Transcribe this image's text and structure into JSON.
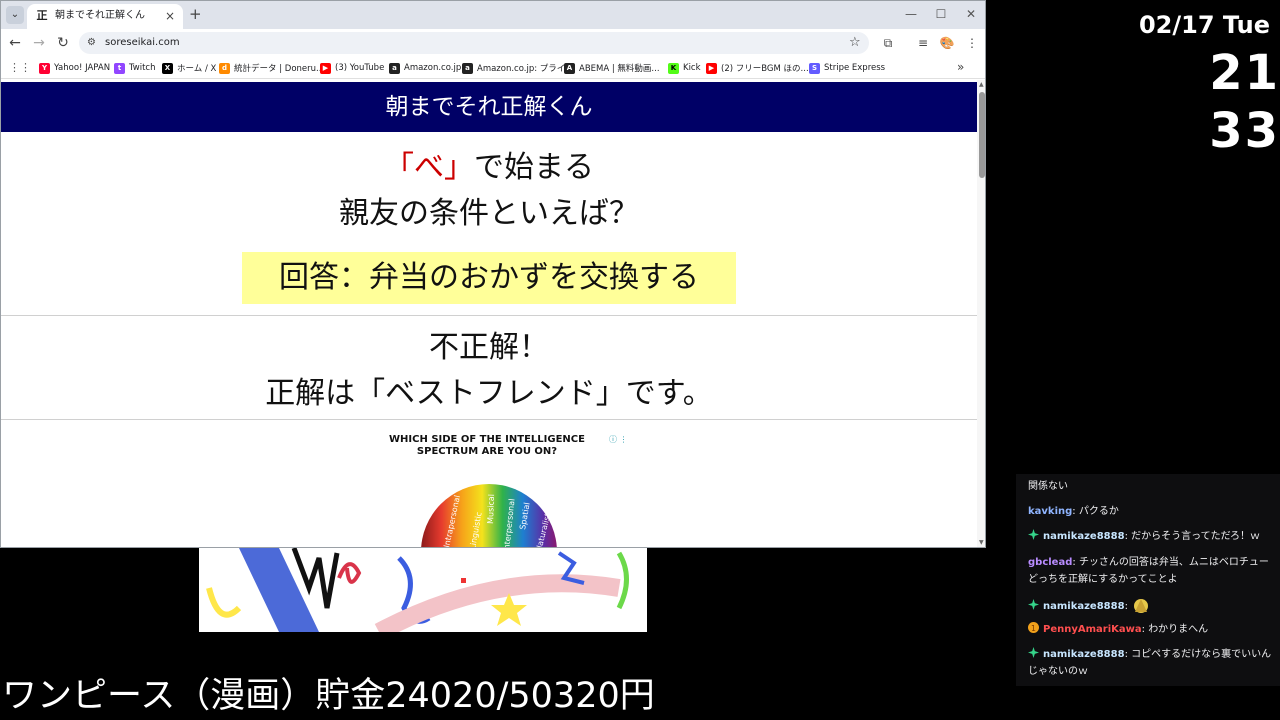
{
  "browser": {
    "tab": {
      "favicon": "正",
      "title": "朝までそれ正解くん",
      "close_icon": "×"
    },
    "new_tab_icon": "+",
    "window_controls": {
      "minimize": "—",
      "maximize": "☐",
      "close": "✕"
    },
    "tab_list_icon": "⌄",
    "toolbar": {
      "back_icon": "←",
      "forward_icon": "→",
      "reload_icon": "↻",
      "url": "soreseikai.com",
      "star_icon": "☆",
      "extensions_icon": "⧉",
      "media_icon": "≡",
      "profile_icon": "🎨",
      "menu_icon": "⋮",
      "site_info_icon": "⚙"
    },
    "bookmarks": [
      {
        "label": "Yahoo! JAPAN",
        "icon": "Y",
        "color": "#ff0033"
      },
      {
        "label": "Twitch",
        "icon": "t",
        "color": "#9146ff"
      },
      {
        "label": "ホーム / X",
        "icon": "X",
        "color": "#000000"
      },
      {
        "label": "統計データ | Doneru...",
        "icon": "d",
        "color": "#ff8a00"
      },
      {
        "label": "(3) YouTube",
        "icon": "▶",
        "color": "#ff0000"
      },
      {
        "label": "Amazon.co.jp",
        "icon": "a",
        "color": "#222222"
      },
      {
        "label": "Amazon.co.jp: プライ...",
        "icon": "a",
        "color": "#222222"
      },
      {
        "label": "ABEMA | 無料動画...",
        "icon": "A",
        "color": "#222222"
      },
      {
        "label": "Kick",
        "icon": "K",
        "color": "#53fc18"
      },
      {
        "label": "(2) フリーBGM ほの...",
        "icon": "▶",
        "color": "#ff0000"
      },
      {
        "label": "Stripe Express",
        "icon": "S",
        "color": "#635bff"
      }
    ],
    "bookmarks_more": "»",
    "apps_icon": "⋮⋮"
  },
  "page": {
    "header": "朝までそれ正解くん",
    "question_letter": "「べ」",
    "question_line1_rest": "で始まる",
    "question_line2": "親友の条件といえば？",
    "answer": "回答：弁当のおかずを交換する",
    "result_line1": "不正解！",
    "result_line2": "正解は「ベストフレンド」です。",
    "ad": {
      "title": "WHICH SIDE OF THE INTELLIGENCE SPECTRUM ARE YOU ON?",
      "info_icon": "ⓘ ⋮",
      "labels": [
        "Intrapersonal",
        "Linguistic",
        "Musical",
        "Interpersonal",
        "Spatial",
        "Naturalist"
      ]
    }
  },
  "overlay": {
    "date": "02/17 Tue",
    "time": "21 33",
    "savings": "ワンピース（漫画）貯金24020/50320円"
  },
  "chat": [
    {
      "user": "",
      "text": "関係ない",
      "user_color": "#efeff1",
      "badge": ""
    },
    {
      "user": "kavking",
      "text": "パクるか",
      "user_color": "#8fb4ff",
      "badge": ""
    },
    {
      "user": "namikaze8888",
      "text": "だからそう言ってただろ！ｗ",
      "user_color": "#c8e6ff",
      "badge": "star"
    },
    {
      "user": "gbclead",
      "text": "チッさんの回答は弁当、ムニはベロチュー どっちを正解にするかってことよ",
      "user_color": "#b98cff",
      "badge": ""
    },
    {
      "user": "namikaze8888",
      "text": "",
      "user_color": "#c8e6ff",
      "badge": "star"
    },
    {
      "user": "PennyAmariKawa",
      "text": "わかりまへん",
      "user_color": "#ff4f4f",
      "badge": "coin"
    },
    {
      "user": "namikaze8888",
      "text": "コピペするだけなら裏でいいんじゃないのｗ",
      "user_color": "#c8e6ff",
      "badge": "star"
    }
  ]
}
